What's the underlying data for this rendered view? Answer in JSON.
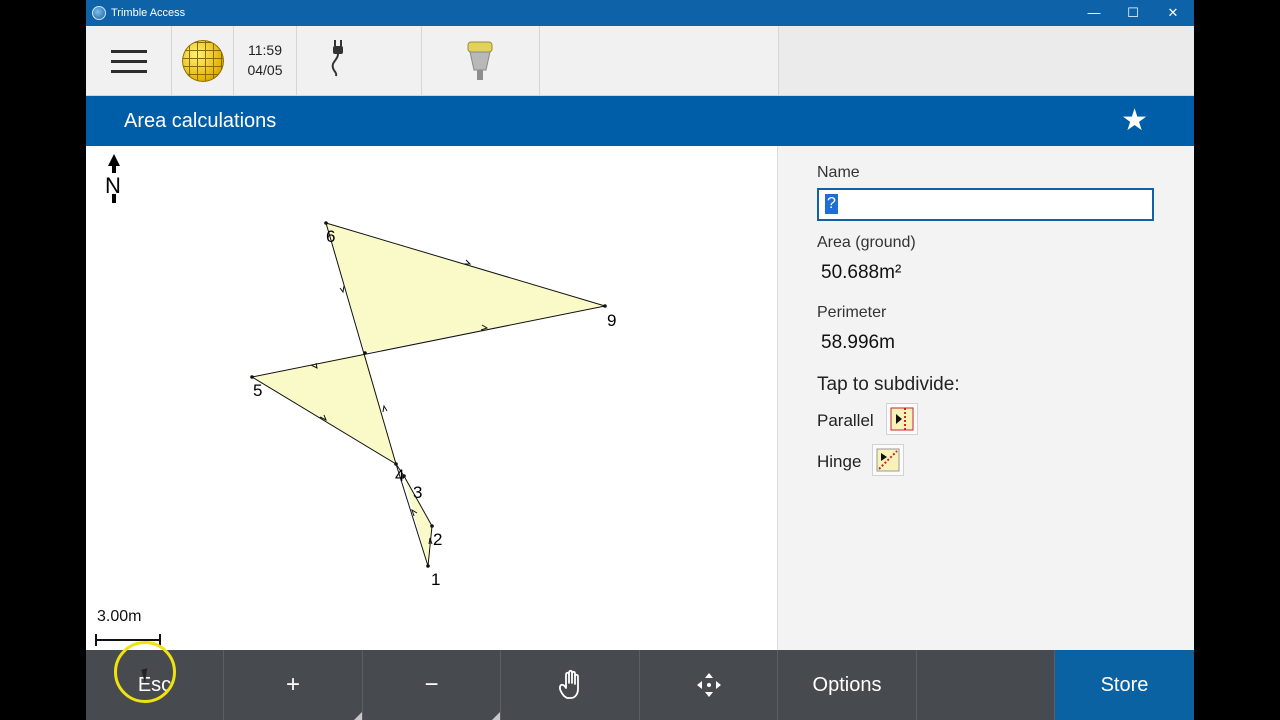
{
  "window": {
    "title": "Trimble Access",
    "minimize_glyph": "—",
    "maximize_glyph": "☐",
    "close_glyph": "✕"
  },
  "statusbar": {
    "time": "11:59",
    "date": "04/05",
    "icons": [
      "menu-icon",
      "globe-icon",
      "power-plug-icon",
      "gnss-receiver-icon"
    ]
  },
  "header": {
    "title": "Area calculations",
    "favorite_glyph": "★"
  },
  "map": {
    "north_label": "N",
    "scale_label": "3.00m",
    "points": [
      "6",
      "9",
      "5",
      "4",
      "3",
      "2",
      "1"
    ],
    "fill_color": "#fafac8"
  },
  "panel": {
    "name_label": "Name",
    "name_value": "?",
    "area_label": "Area (ground)",
    "area_value": "50.688m²",
    "perimeter_label": "Perimeter",
    "perimeter_value": "58.996m",
    "subdivide_label": "Tap to subdivide:",
    "parallel_label": "Parallel",
    "hinge_label": "Hinge"
  },
  "bottombar": {
    "esc": "Esc",
    "zoom_in": "+",
    "zoom_out": "−",
    "options": "Options",
    "store": "Store"
  },
  "colors": {
    "titlebar": "#0e63a8",
    "header": "#005ea8",
    "bottombar": "#474a4e",
    "store": "#0b62a3"
  }
}
